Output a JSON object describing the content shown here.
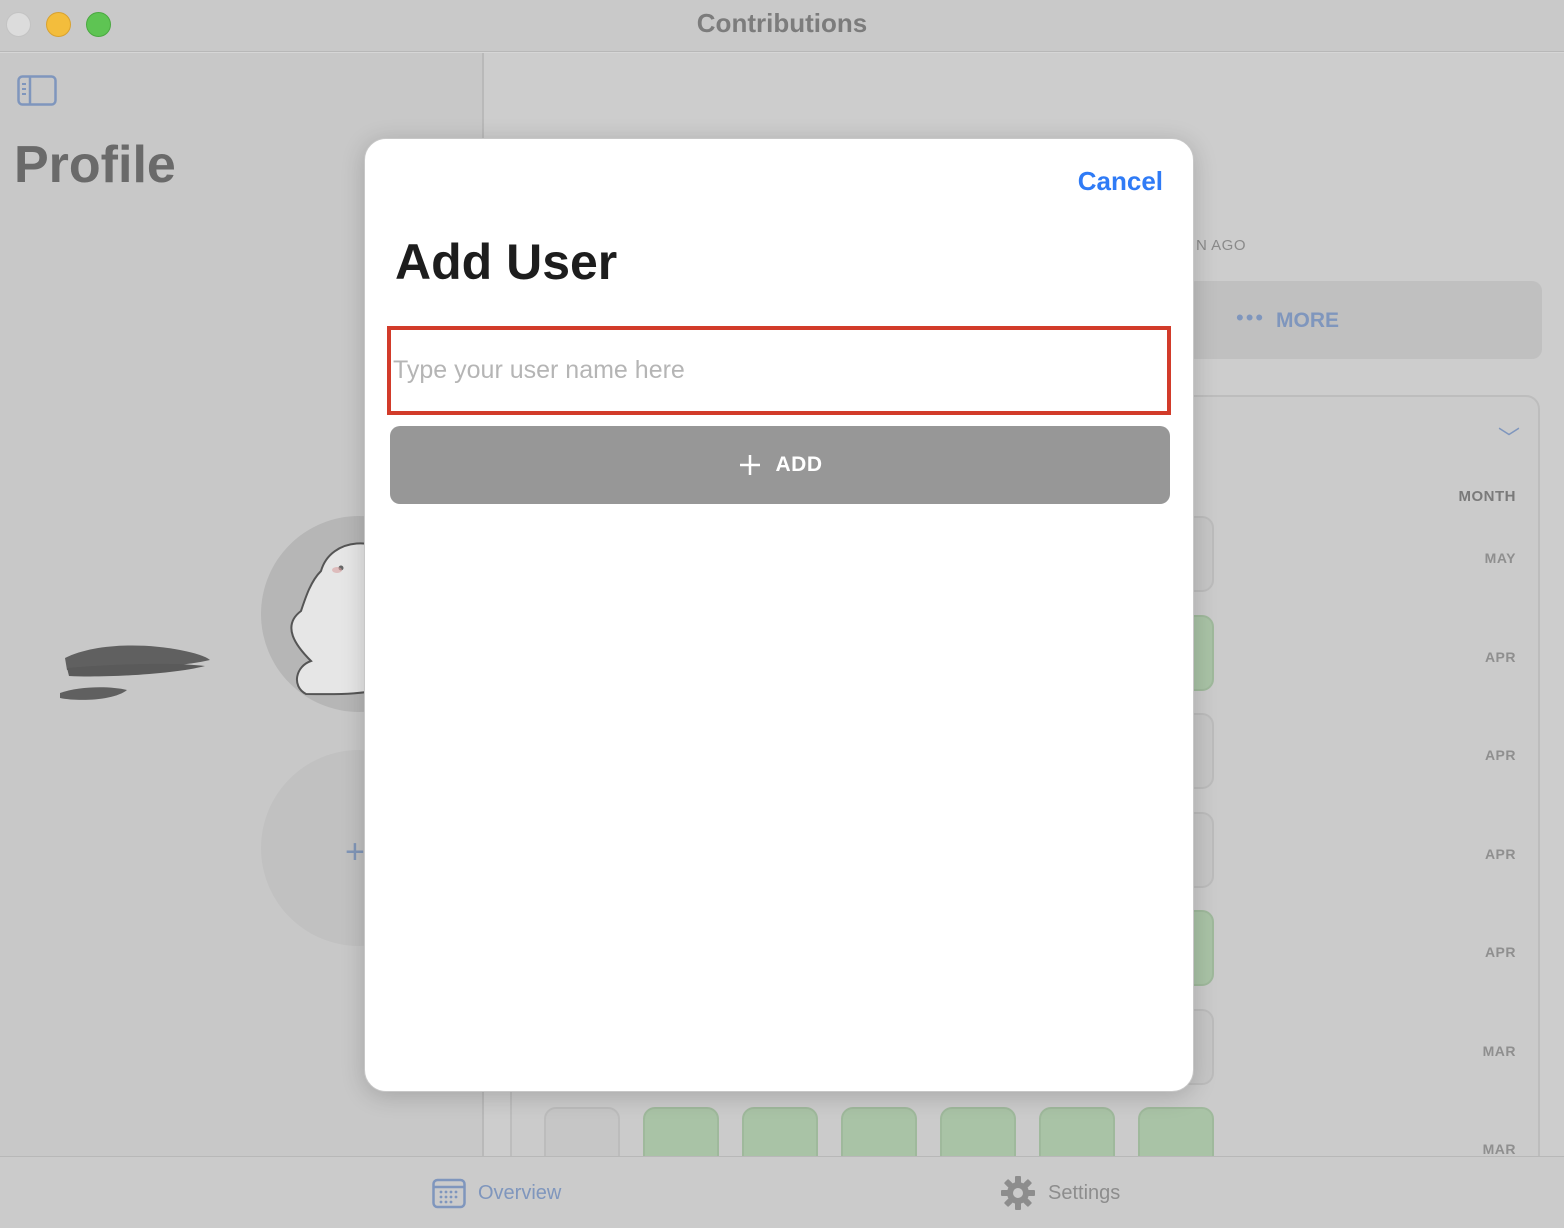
{
  "window": {
    "title": "Contributions"
  },
  "sidebar": {
    "title": "Profile"
  },
  "main": {
    "time_ago_label": "N AGO",
    "more_label": "MORE",
    "more_icon": "ellipsis-icon",
    "month_header": "MONTH",
    "months": [
      "MAY",
      "APR",
      "APR",
      "APR",
      "APR",
      "MAR",
      "MAR"
    ]
  },
  "tabbar": {
    "overview_label": "Overview",
    "settings_label": "Settings"
  },
  "modal": {
    "cancel_label": "Cancel",
    "title": "Add User",
    "username_placeholder": "Type your user name here",
    "username_value": "",
    "add_label": "ADD",
    "add_icon": "plus-icon"
  },
  "colors": {
    "accent": "#2f7bf6",
    "highlight_border": "#d23b2a",
    "add_button_bg": "#979797",
    "contribution_green": "#a9c3a6"
  }
}
